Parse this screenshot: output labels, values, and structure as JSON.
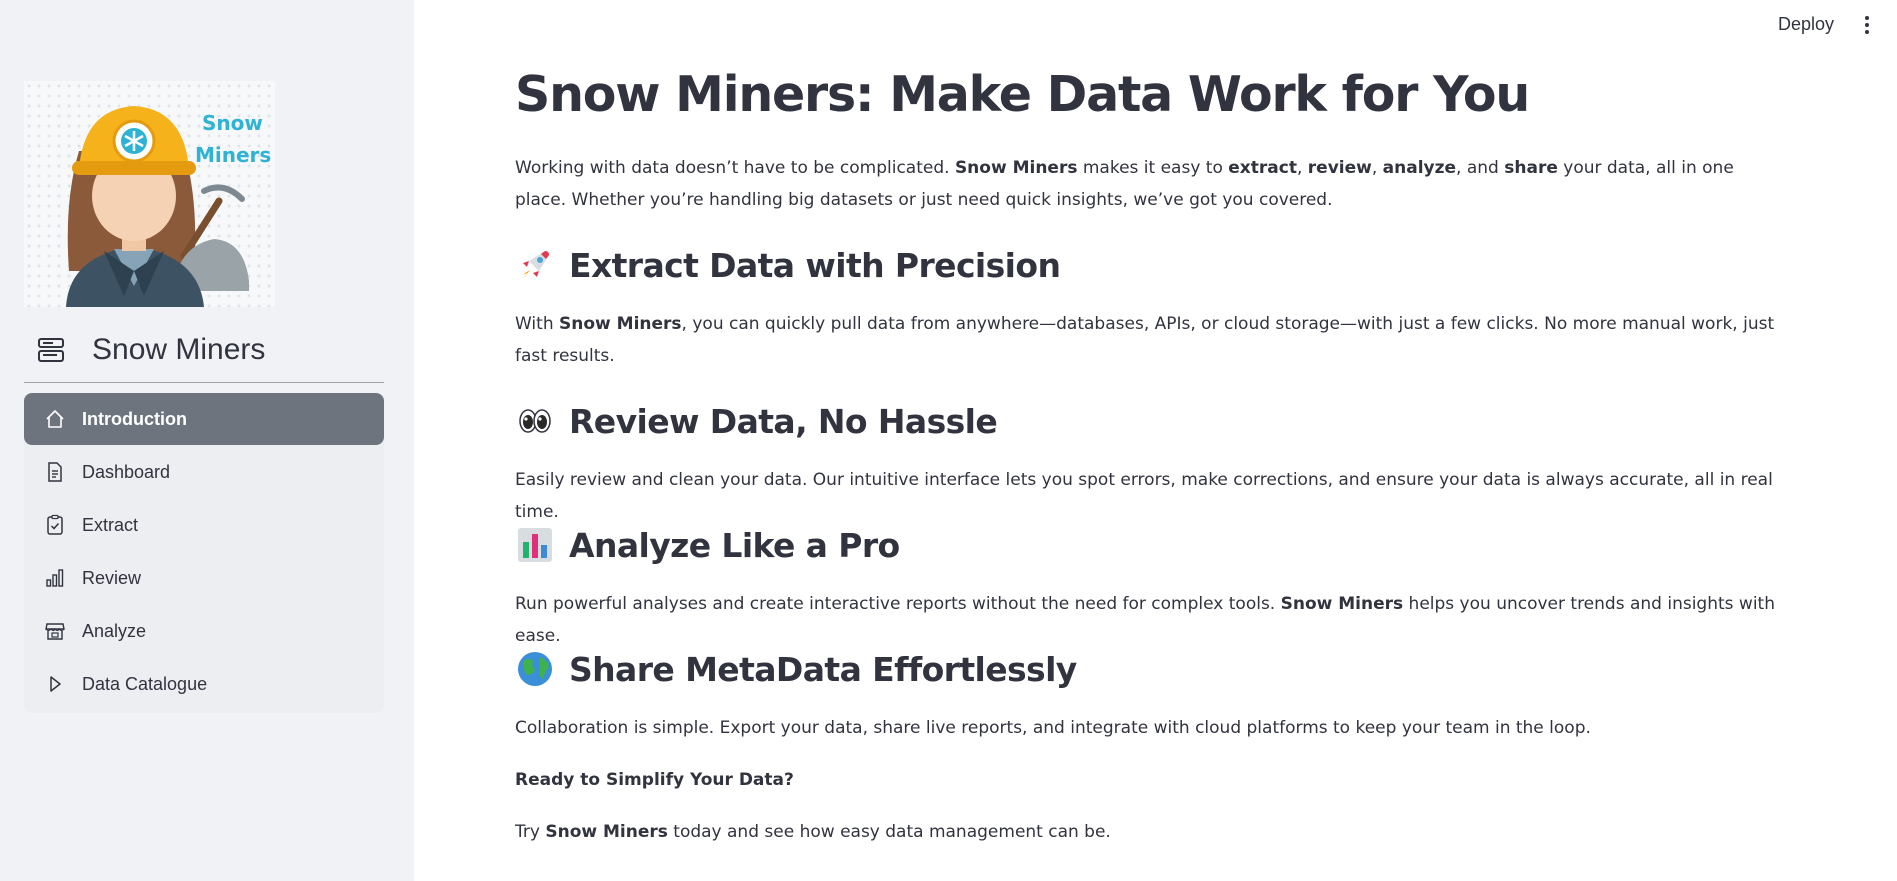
{
  "app": {
    "deploy_label": "Deploy"
  },
  "sidebar": {
    "logo_text_line1": "Snow",
    "logo_text_line2": "Miners",
    "brand_title": "Snow Miners",
    "items": [
      {
        "label": "Introduction",
        "icon": "home-icon",
        "active": true
      },
      {
        "label": "Dashboard",
        "icon": "document-icon",
        "active": false
      },
      {
        "label": "Extract",
        "icon": "clipboard-check-icon",
        "active": false
      },
      {
        "label": "Review",
        "icon": "bar-chart-icon",
        "active": false
      },
      {
        "label": "Analyze",
        "icon": "shop-icon",
        "active": false
      },
      {
        "label": "Data Catalogue",
        "icon": "play-icon",
        "active": false
      }
    ]
  },
  "main": {
    "title": "Snow Miners: Make Data Work for You",
    "intro": {
      "t1": "Working with data doesn’t have to be complicated. ",
      "b1": "Snow Miners",
      "t2": " makes it easy to ",
      "b2": "extract",
      "t3": ", ",
      "b3": "review",
      "t4": ", ",
      "b4": "analyze",
      "t5": ", and ",
      "b5": "share",
      "t6": " your data, all in one place. Whether you’re handling big datasets or just need quick insights, we’ve got you covered."
    },
    "sections": [
      {
        "heading": "Extract Data with Precision",
        "icon": "rocket-icon",
        "t1": "With ",
        "b1": "Snow Miners",
        "t2": ", you can quickly pull data from anywhere—databases, APIs, or cloud storage—with just a few clicks. No more manual work, just fast results."
      },
      {
        "heading": "Review Data, No Hassle",
        "icon": "eyes-icon",
        "t1": "Easily review and clean your data. Our intuitive interface lets you spot errors, make corrections, and ensure your data is always accurate, all in real time."
      },
      {
        "heading": "Analyze Like a Pro",
        "icon": "bar-chart-emoji-icon",
        "t1": "Run powerful analyses and create interactive reports without the need for complex tools. ",
        "b1": "Snow Miners",
        "t2": " helps you uncover trends and insights with ease."
      },
      {
        "heading": "Share MetaData Effortlessly",
        "icon": "globe-icon",
        "t1": "Collaboration is simple. Export your data, share live reports, and integrate with cloud platforms to keep your team in the loop."
      }
    ],
    "cta_heading": "Ready to Simplify Your Data?",
    "cta": {
      "t1": "Try ",
      "b1": "Snow Miners",
      "t2": " today and see how easy data management can be."
    }
  },
  "colors": {
    "sidebar_bg": "#f0f2f6",
    "active_item_bg": "#6d747d",
    "text": "#31333f",
    "logo_accent": "#2fb3d4"
  }
}
